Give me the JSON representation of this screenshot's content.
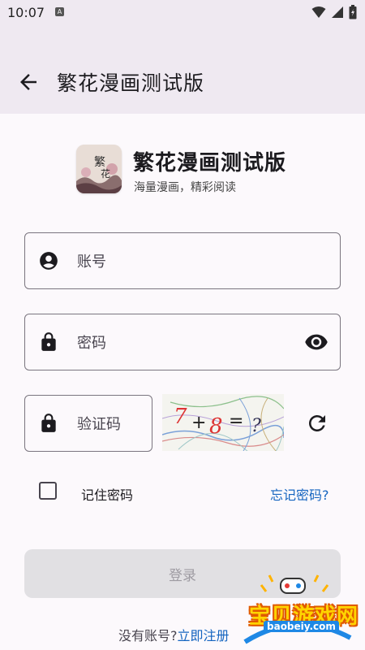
{
  "status_bar": {
    "time": "10:07",
    "notif_letter": "A"
  },
  "app_bar": {
    "title": "繁花漫画测试版"
  },
  "brand": {
    "name": "繁花漫画测试版",
    "slogan": "海量漫画，精彩阅读"
  },
  "form": {
    "account_placeholder": "账号",
    "password_placeholder": "密码",
    "captcha_placeholder": "验证码",
    "captcha_text": [
      "7",
      "+",
      "8",
      "=",
      "?"
    ]
  },
  "options": {
    "remember_label": "记住密码",
    "forgot_label": "忘记密码?"
  },
  "actions": {
    "login_label": "登录",
    "no_account_text": "没有账号?",
    "register_label": "立即注册"
  },
  "watermark": {
    "text": "宝贝游戏网",
    "url": "baobeiy.com"
  },
  "colors": {
    "appbar_bg": "#efe9f1",
    "link": "#1565c0",
    "button_disabled_bg": "#e1e0e3"
  },
  "icons": [
    "back-arrow-icon",
    "person-icon",
    "lock-icon",
    "eye-icon",
    "refresh-icon",
    "wifi-icon",
    "signal-icon",
    "battery-icon"
  ]
}
